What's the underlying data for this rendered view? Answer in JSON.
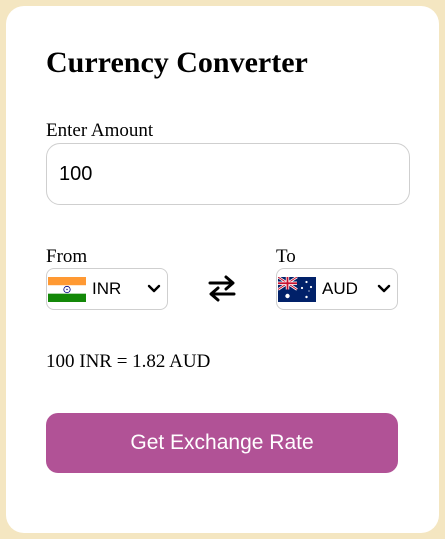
{
  "title": "Currency Converter",
  "amount": {
    "label": "Enter Amount",
    "value": "100"
  },
  "from": {
    "label": "From",
    "currency": "INR",
    "flag_icon": "india-flag-icon"
  },
  "to": {
    "label": "To",
    "currency": "AUD",
    "flag_icon": "australia-flag-icon"
  },
  "swap_icon": "swap-arrows-icon",
  "result": "100 INR = 1.82 AUD",
  "button": {
    "label": "Get Exchange Rate"
  },
  "colors": {
    "page_background": "#f4e6c1",
    "card_background": "#ffffff",
    "button_background": "#b15296",
    "button_text": "#ffffff"
  }
}
